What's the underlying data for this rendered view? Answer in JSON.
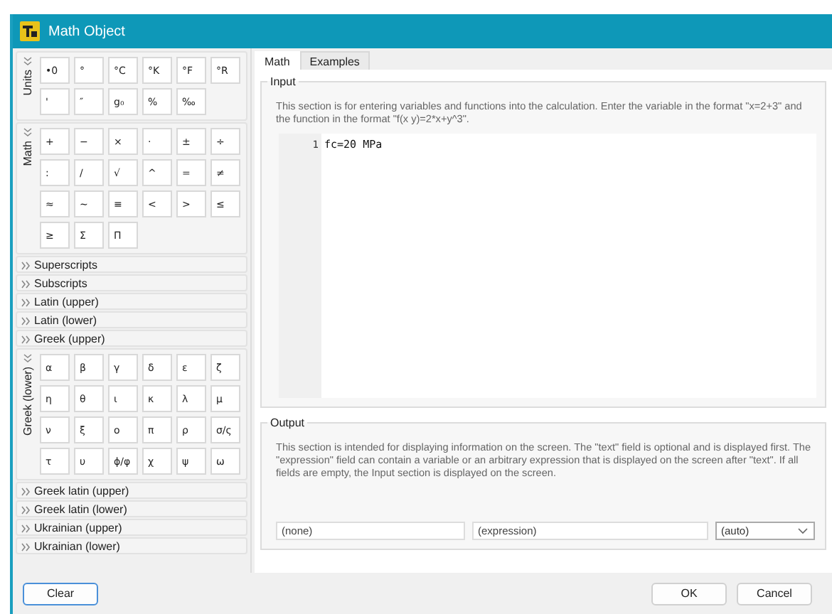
{
  "window": {
    "title": "Math Object"
  },
  "groups": [
    {
      "label": "Units",
      "expanded": true,
      "symbols": [
        "•0",
        "°",
        "°C",
        "°K",
        "°F",
        "°R",
        "'",
        "″",
        "g₀",
        "%",
        "‰"
      ]
    },
    {
      "label": "Math",
      "expanded": true,
      "symbols": [
        "+",
        "−",
        "×",
        "·",
        "±",
        "÷",
        ":",
        "/",
        "√",
        "^",
        "=",
        "≠",
        "≈",
        "~",
        "≡",
        "<",
        ">",
        "≤",
        "≥",
        "Σ",
        "Π"
      ]
    },
    {
      "label": "Superscripts",
      "expanded": false
    },
    {
      "label": "Subscripts",
      "expanded": false
    },
    {
      "label": "Latin (upper)",
      "expanded": false
    },
    {
      "label": "Latin (lower)",
      "expanded": false
    },
    {
      "label": "Greek (upper)",
      "expanded": false
    },
    {
      "label": "Greek (lower)",
      "expanded": true,
      "symbols": [
        "α",
        "β",
        "γ",
        "δ",
        "ε",
        "ζ",
        "η",
        "θ",
        "ι",
        "κ",
        "λ",
        "μ",
        "ν",
        "ξ",
        "ο",
        "π",
        "ρ",
        "σ/ς",
        "τ",
        "υ",
        "ϕ/φ",
        "χ",
        "ψ",
        "ω"
      ]
    },
    {
      "label": "Greek latin (upper)",
      "expanded": false
    },
    {
      "label": "Greek latin (lower)",
      "expanded": false
    },
    {
      "label": "Ukrainian (upper)",
      "expanded": false
    },
    {
      "label": "Ukrainian (lower)",
      "expanded": false
    }
  ],
  "tabs": [
    {
      "label": "Math",
      "selected": true
    },
    {
      "label": "Examples",
      "selected": false
    }
  ],
  "input": {
    "legend": "Input",
    "description": "This section is for entering variables and functions into the calculation. Enter the variable in the format \"x=2+3\" and the function in the format \"f(x y)=2*x+y^3\".",
    "lines": [
      {
        "number": "1",
        "text": "fc=20 MPa"
      }
    ]
  },
  "output": {
    "legend": "Output",
    "description": "This section is intended for displaying information on the screen. The \"text\" field is optional and is displayed first. The \"expression\" field can contain a variable or an arbitrary expression that is displayed on the screen after \"text\". If all fields are empty, the Input section is displayed on the screen.",
    "text_placeholder": "(none)",
    "expression_placeholder": "(expression)",
    "format": "(auto)"
  },
  "buttons": {
    "clear": "Clear",
    "ok": "OK",
    "cancel": "Cancel"
  }
}
